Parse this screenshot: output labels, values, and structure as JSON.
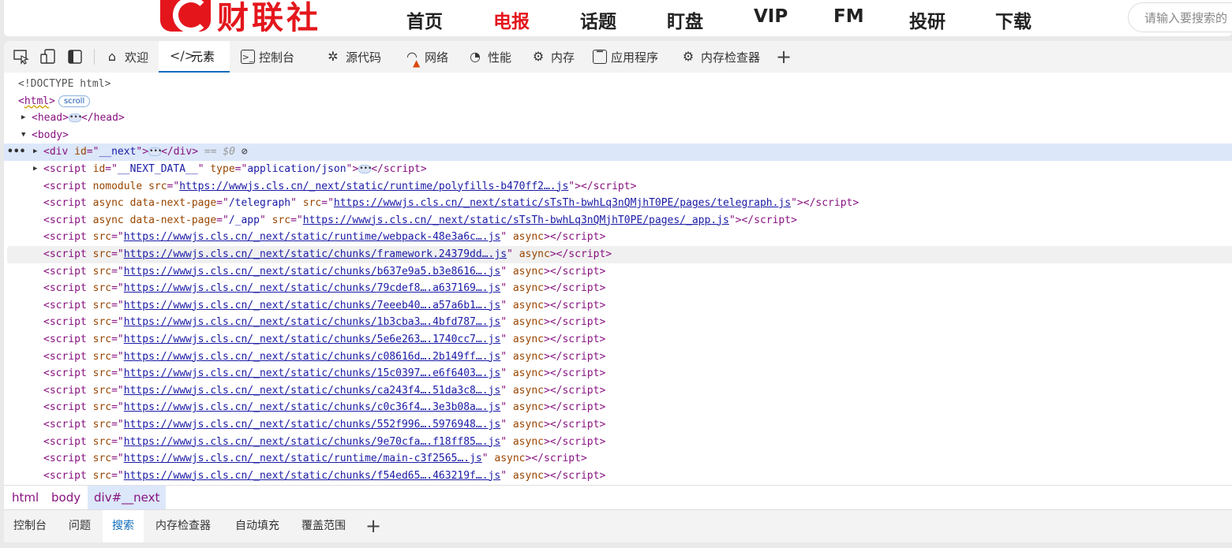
{
  "site": {
    "brand": "财联社",
    "nav": [
      "首页",
      "电报",
      "话题",
      "盯盘",
      "VIP",
      "FM",
      "投研",
      "下载"
    ],
    "active_nav": "电报",
    "search_placeholder": "请输入要搜索的"
  },
  "devtools": {
    "tabs": [
      {
        "label": "欢迎",
        "icon": "home-icon"
      },
      {
        "label": "元素",
        "icon": "code-icon"
      },
      {
        "label": "控制台",
        "icon": "console-icon"
      },
      {
        "label": "源代码",
        "icon": "bug-icon"
      },
      {
        "label": "网络",
        "icon": "wifi-warning-icon"
      },
      {
        "label": "性能",
        "icon": "gauge-icon"
      },
      {
        "label": "内存",
        "icon": "chip-icon"
      },
      {
        "label": "应用程序",
        "icon": "app-icon"
      },
      {
        "label": "内存检查器",
        "icon": "memory-inspector-icon"
      }
    ],
    "active_tab": "元素",
    "dom": {
      "doctype": "<!DOCTYPE html>",
      "html_tag": "html",
      "scroll_badge": "scroll",
      "head_tag": "head",
      "body_tag": "body",
      "div_id": "__next",
      "div_marker": "== $0",
      "script_next_data_id": "__NEXT_DATA__",
      "script_next_data_type": "application/json",
      "polyfills_src": "https://wwwjs.cls.cn/_next/static/runtime/polyfills-b470ff2….js",
      "telegraph_page": "/telegraph",
      "telegraph_src": "https://wwwjs.cls.cn/_next/static/sTsTh-bwhLq3nQMjhT0PE/pages/telegraph.js",
      "app_page": "/_app",
      "app_src": "https://wwwjs.cls.cn/_next/static/sTsTh-bwhLq3nQMjhT0PE/pages/_app.js",
      "async_scripts": [
        "https://wwwjs.cls.cn/_next/static/runtime/webpack-48e3a6c….js",
        "https://wwwjs.cls.cn/_next/static/chunks/framework.24379dd….js",
        "https://wwwjs.cls.cn/_next/static/chunks/b637e9a5.b3e8616….js",
        "https://wwwjs.cls.cn/_next/static/chunks/79cdef8….a637169….js",
        "https://wwwjs.cls.cn/_next/static/chunks/7eeeb40….a57a6b1….js",
        "https://wwwjs.cls.cn/_next/static/chunks/1b3cba3….4bfd787….js",
        "https://wwwjs.cls.cn/_next/static/chunks/5e6e263….1740cc7….js",
        "https://wwwjs.cls.cn/_next/static/chunks/c08616d….2b149ff….js",
        "https://wwwjs.cls.cn/_next/static/chunks/15c0397….e6f6403….js",
        "https://wwwjs.cls.cn/_next/static/chunks/ca243f4….51da3c8….js",
        "https://wwwjs.cls.cn/_next/static/chunks/c0c36f4….3e3b08a….js",
        "https://wwwjs.cls.cn/_next/static/chunks/552f996….5976948….js",
        "https://wwwjs.cls.cn/_next/static/chunks/9e70cfa….f18ff85….js",
        "https://wwwjs.cls.cn/_next/static/runtime/main-c3f2565….js",
        "https://wwwjs.cls.cn/_next/static/chunks/f54ed65….463219f….js"
      ]
    },
    "breadcrumbs": [
      "html",
      "body",
      "div#__next"
    ],
    "active_breadcrumb": "div#__next",
    "drawer_tabs": [
      "控制台",
      "问题",
      "搜索",
      "内存检查器",
      "自动填充",
      "覆盖范围"
    ],
    "active_drawer_tab": "搜索"
  }
}
